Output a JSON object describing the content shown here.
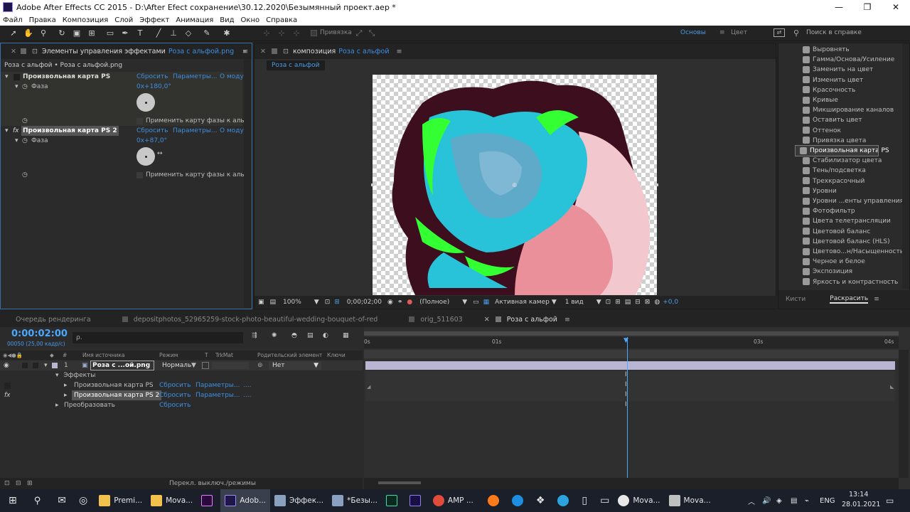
{
  "window": {
    "title": "Adobe After Effects CC 2015 - D:\\After Efect сохранение\\30.12.2020\\Безымянный проект.aep *",
    "min": "—",
    "max": "❐",
    "close": "✕"
  },
  "menu": [
    "Файл",
    "Правка",
    "Композиция",
    "Слой",
    "Эффект",
    "Анимация",
    "Вид",
    "Окно",
    "Справка"
  ],
  "toolbar": {
    "snap_label": "Привязка",
    "workspace_main": "Основы",
    "workspace_color": "Цвет",
    "search_placeholder": "Поиск в справке"
  },
  "effect_controls": {
    "tab_title": "Элементы управления эффектами",
    "tab_layer": "Роза с альфой.png",
    "breadcrumb": "Роза с альфой • Роза с альфой.png",
    "effects": [
      {
        "name": "Произвольная карта PS",
        "reset": "Сбросить",
        "params": "Параметры...",
        "about": "О моду",
        "phase_label": "Фаза",
        "phase_value": "0x+180,0°",
        "apply_label": "Применить карту фазы к аль"
      },
      {
        "name": "Произвольная карта PS 2",
        "reset": "Сбросить",
        "params": "Параметры...",
        "about": "О моду",
        "phase_label": "Фаза",
        "phase_value": "0x+87,0°",
        "apply_label": "Применить карту фазы к аль"
      }
    ]
  },
  "composition": {
    "tab_label": "композиция",
    "tab_name": "Роза с альфой",
    "flow_tab": "Роза с альфой",
    "footer": {
      "zoom": "100%",
      "time": "0;00;02;00",
      "resolution": "(Полное)",
      "camera": "Активная камер",
      "views": "1 вид",
      "exposure": "+0,0"
    }
  },
  "effects_list": {
    "items": [
      "Выровнять",
      "Гамма/Основа/Усиление",
      "Заменить на цвет",
      "Изменить цвет",
      "Красочность",
      "Кривые",
      "Микширование каналов",
      "Оставить цвет",
      "Оттенок",
      "Привязка цвета",
      "Произвольная карта PS",
      "Стабилизатор цвета",
      "Тень/подсветка",
      "Трехкрасочный",
      "Уровни",
      "Уровни ...енты управления)",
      "Фотофильтр",
      "Цвета телетрансляции",
      "Цветовой баланс",
      "Цветовой баланс (HLS)",
      "Цветово...н/Насыщенность",
      "Черное и белое",
      "Экспозиция",
      "Яркость и контрастность"
    ],
    "selected_index": 10,
    "tab_brushes": "Кисти",
    "tab_paint": "Раскрасить"
  },
  "timeline": {
    "tabs": [
      "Очередь рендеринга",
      "depositphotos_52965259-stock-photo-beautiful-wedding-bouquet-of-red",
      "orig_511603",
      "Роза с альфой"
    ],
    "timecode": "0:00:02:00",
    "timecode_sub": "00050 (25,00 кадр/с)",
    "search_placeholder": "ρ.",
    "columns": {
      "source": "Имя источника",
      "mode": "Режим",
      "t": "T",
      "trkmat": "TrkMat",
      "parent": "Родительский элемент",
      "keys": "Ключи"
    },
    "layer": {
      "num": "1",
      "name": "Роза с ...ой.png",
      "mode": "Нормаль",
      "parent": "Нет"
    },
    "effects_group": "Эффекты",
    "effect_rows": [
      {
        "name": "Произвольная карта PS",
        "reset": "Сбросить",
        "params": "Параметры...",
        "dots": "...."
      },
      {
        "name": "Произвольная карта PS 2",
        "reset": "Сбросить",
        "params": "Параметры...",
        "dots": "...."
      }
    ],
    "transform": {
      "name": "Преобразовать",
      "reset": "Сбросить"
    },
    "ruler": [
      "0s",
      "01s",
      "03s",
      "04s"
    ],
    "toggle_modes": "Перекл. выключ./режимы",
    "fx_label": "fx"
  },
  "taskbar": {
    "items": [
      "Premi...",
      "Mova...",
      "Adob...",
      "Эффек...",
      "*Безы...",
      "AMP ...",
      "Mova...",
      "Mova..."
    ],
    "lang": "ENG",
    "time": "13:14",
    "date": "28.01.2021"
  },
  "colors": {
    "accent": "#3d8fe0",
    "timecode": "#4aa8ff",
    "playhead": "#4aa8ff",
    "layer_bar": "#b9b5d3"
  }
}
